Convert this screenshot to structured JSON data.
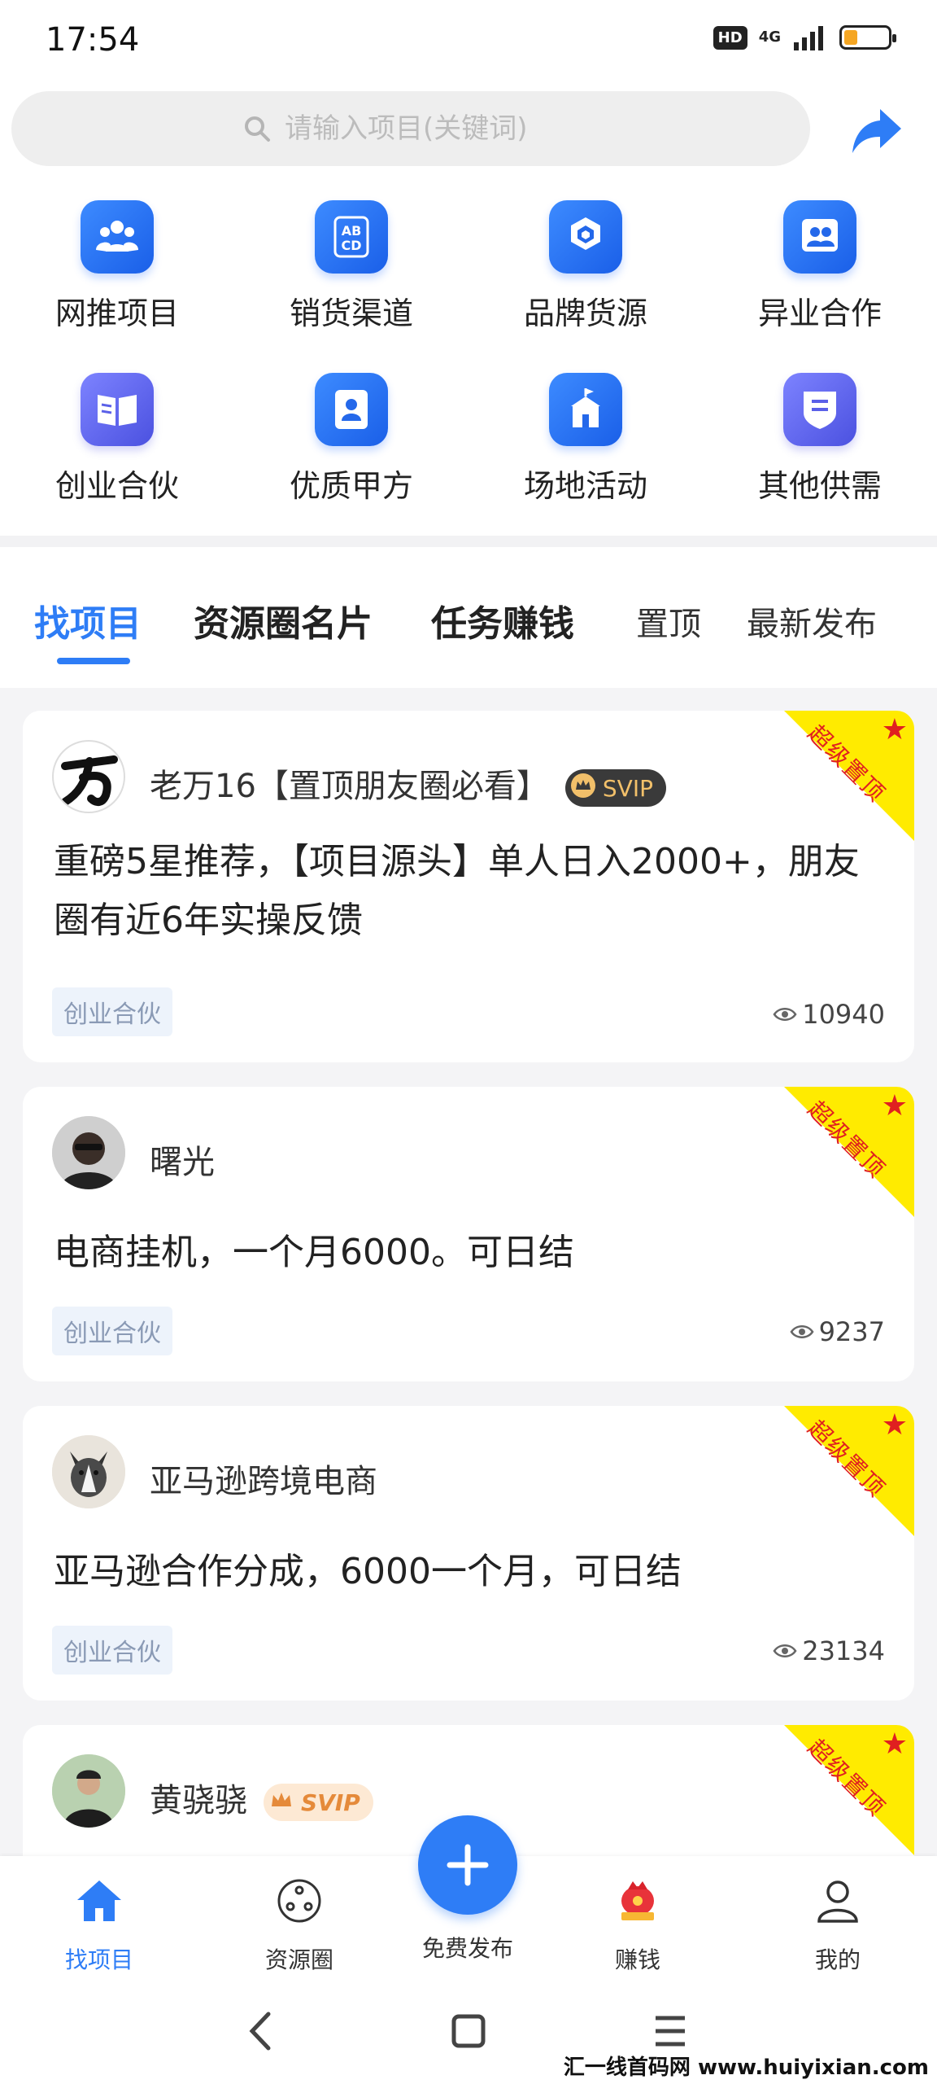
{
  "status_bar": {
    "time": "17:54",
    "hd": "HD",
    "network": "4G",
    "battery_level": 0.3
  },
  "search": {
    "placeholder": "请输入项目(关键词)"
  },
  "categories": [
    {
      "label": "网推项目",
      "icon": "people-group-icon"
    },
    {
      "label": "销货渠道",
      "icon": "abcd-icon"
    },
    {
      "label": "品牌货源",
      "icon": "cubes-icon"
    },
    {
      "label": "异业合作",
      "icon": "partners-icon"
    },
    {
      "label": "创业合伙",
      "icon": "open-book-icon"
    },
    {
      "label": "优质甲方",
      "icon": "id-card-icon"
    },
    {
      "label": "场地活动",
      "icon": "venue-icon"
    },
    {
      "label": "其他供需",
      "icon": "shield-list-icon"
    }
  ],
  "tabs": [
    {
      "label": "找项目",
      "active": true
    },
    {
      "label": "资源圈名片"
    },
    {
      "label": "任务赚钱"
    },
    {
      "label": "置顶"
    },
    {
      "label": "最新发布"
    }
  ],
  "ribbon_text": "超级置顶",
  "posts": [
    {
      "author": "老万16【置顶朋友圈必看】",
      "badge": "SVIP",
      "title": "重磅5星推荐，【项目源头】单人日入2000+，朋友圈有近6年实操反馈",
      "tag": "创业合伙",
      "views": "10940"
    },
    {
      "author": "曙光",
      "title": "电商挂机，一个月6000。可日结",
      "tag": "创业合伙",
      "views": "9237"
    },
    {
      "author": "亚马逊跨境电商",
      "title": "亚马逊合作分成，6000一个月，可日结",
      "tag": "创业合伙",
      "views": "23134"
    },
    {
      "author": "黄骁骁",
      "badge": "SVIP"
    }
  ],
  "bottom_nav": [
    {
      "label": "找项目",
      "active": true
    },
    {
      "label": "资源圈"
    },
    {
      "label": "免费发布"
    },
    {
      "label": "赚钱"
    },
    {
      "label": "我的"
    }
  ],
  "watermark": "汇一线首码网 www.huiyixian.com",
  "colors": {
    "primary": "#2e7df6",
    "ribbon": "#ffeb00",
    "ribbon_text": "#e02020"
  }
}
